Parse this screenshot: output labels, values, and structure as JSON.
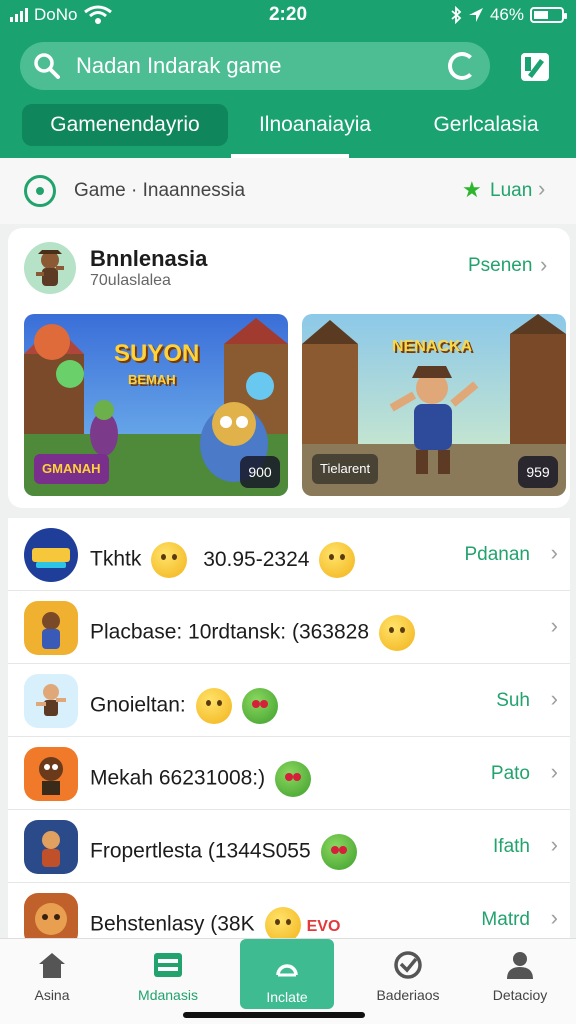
{
  "status_bar": {
    "carrier": "DoNo",
    "time": "2:20",
    "battery": "46%"
  },
  "search": {
    "placeholder": "Nadan Indarak game"
  },
  "tabs": [
    {
      "label": "Gamenendayrio",
      "active": true
    },
    {
      "label": "Ilnoanaiayia",
      "active": false
    },
    {
      "label": "Gerlcalasia",
      "active": false
    }
  ],
  "breadcrumb": {
    "path": "Game · Inaannessia",
    "action": "Luan"
  },
  "featured": {
    "title": "Bnnlenasia",
    "subtitle": "70ulaslalea",
    "action": "Psenen",
    "shots": [
      {
        "logo": "SUYON",
        "logo_sub": "BEMAH",
        "tag": "GMANAH",
        "badge": "900"
      },
      {
        "logo": "NENACKA",
        "tag": "Tielarent",
        "badge": "959"
      }
    ]
  },
  "list": [
    {
      "name": "Tkhtk",
      "extra": "30.95-2324",
      "emoji": [
        "y",
        "y"
      ],
      "action": "Pdanan"
    },
    {
      "name": "Placbase: 10rdtansk: (363828",
      "extra": "",
      "emoji": [
        "y"
      ],
      "action": ""
    },
    {
      "name": "Gnoieltan:",
      "extra": "",
      "emoji": [
        "y",
        "g"
      ],
      "action": "Suh"
    },
    {
      "name": "Mekah 66231008:)",
      "extra": "",
      "emoji": [
        "g"
      ],
      "action": "Pato"
    },
    {
      "name": "Fropertlesta (1344S055",
      "extra": "",
      "emoji": [
        "g"
      ],
      "action": "Ifath"
    },
    {
      "name": "Behstenlasy (38K",
      "extra": "EVO",
      "emoji": [
        "y"
      ],
      "action": "Matrd"
    }
  ],
  "bottom_nav": [
    {
      "label": "Asina",
      "icon": "home-icon"
    },
    {
      "label": "Mdanasis",
      "icon": "card-icon"
    },
    {
      "label": "Inclate",
      "icon": "play-icon",
      "active": true
    },
    {
      "label": "Baderiaos",
      "icon": "check-circle-icon"
    },
    {
      "label": "Detacioy",
      "icon": "profile-icon"
    }
  ],
  "colors": {
    "brand": "#1aa371",
    "accent_text": "#22a36e",
    "active_nav": "#3fbb91"
  }
}
